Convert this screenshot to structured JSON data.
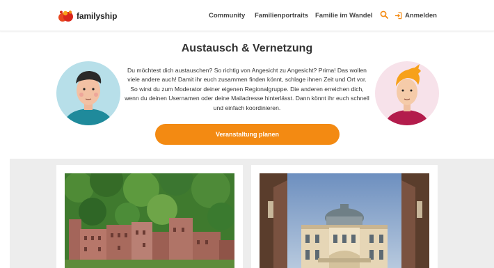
{
  "brand": {
    "name": "familyship",
    "accent": "#f38a12"
  },
  "nav": {
    "community": "Community",
    "portraits": "Familienportraits",
    "wandel": "Familie im Wandel",
    "login": "Anmelden"
  },
  "icons": {
    "search": "search-icon",
    "login": "login-icon"
  },
  "intro": {
    "title": "Austausch & Vernetzung",
    "text": "Du möchtest dich austauschen? So richtig von Angesicht zu Angesicht? Prima! Das wollen viele andere auch! Damit ihr euch zusammen finden könnt, schlage ihnen Zeit und Ort vor. So wirst du zum Moderator deiner eigenen Regionalgruppe. Die anderen erreichen dich, wenn du deinen Usernamen oder deine Mailadresse hinterlässt. Dann könnt ihr euch schnell und einfach koordinieren.",
    "cta": "Veranstaltung planen"
  }
}
